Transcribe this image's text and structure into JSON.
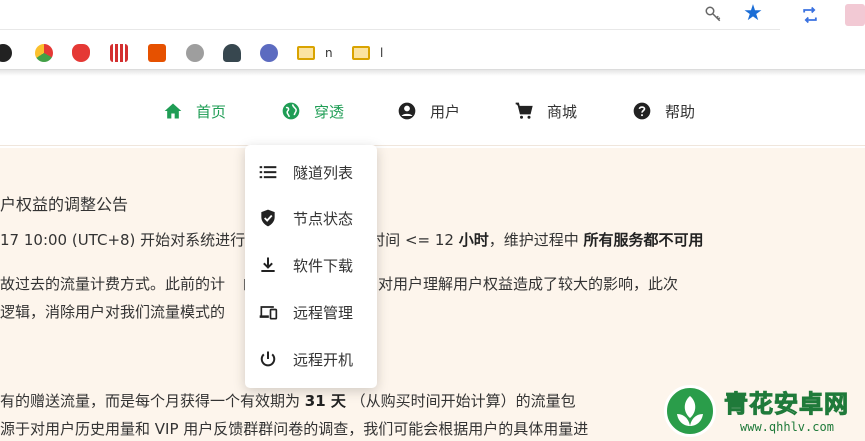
{
  "browser": {
    "icons": [
      "key-icon",
      "star-icon",
      "sync-icon",
      "extension-icon"
    ],
    "bookmarks": [
      {
        "icon": "github-icon",
        "label": ""
      },
      {
        "icon": "browser-icon",
        "label": ""
      },
      {
        "icon": "red-logo-icon",
        "label": ""
      },
      {
        "icon": "huawei-icon",
        "label": ""
      },
      {
        "icon": "orange-app-icon",
        "label": ""
      },
      {
        "icon": "bird-icon",
        "label": ""
      },
      {
        "icon": "tree-icon",
        "label": ""
      },
      {
        "icon": "mascot-icon",
        "label": ""
      },
      {
        "icon": "folder-icon",
        "label": "n"
      },
      {
        "icon": "folder-icon",
        "label": "l"
      }
    ]
  },
  "nav": {
    "items": [
      {
        "label": "首页",
        "icon": "home-icon",
        "active": true
      },
      {
        "label": "穿透",
        "icon": "globe-icon",
        "active": true
      },
      {
        "label": "用户",
        "icon": "account-icon",
        "active": false
      },
      {
        "label": "商城",
        "icon": "cart-icon",
        "active": false
      },
      {
        "label": "帮助",
        "icon": "help-icon",
        "active": false
      }
    ]
  },
  "dropdown": {
    "items": [
      {
        "label": "隧道列表",
        "icon": "list-icon"
      },
      {
        "label": "节点状态",
        "icon": "shield-check-icon"
      },
      {
        "label": "软件下载",
        "icon": "download-icon"
      },
      {
        "label": "远程管理",
        "icon": "devices-icon"
      },
      {
        "label": "远程开机",
        "icon": "power-icon"
      }
    ]
  },
  "content": {
    "line1": "户权益的调整公告",
    "line2_a": "17 10:00 (UTC+8) 开始对系统进行",
    "line2_b": "次维护预计持续时间 <= 12 ",
    "line2_bold1": "小时",
    "line2_c": "，维护过程中 ",
    "line2_bold2": "所有服务都不可用",
    "line3_a": "故过去的流量计费方式。此前的计",
    "line3_b": "的遗留产物，其机制对用户理解用户权益造成了较大的影响，此次",
    "line4_a": "逻辑，消除用户对我们流量模式的",
    "line5_a": "有的赠送流量，而是每个月获得一个有效期为 ",
    "line5_bold": "31 天",
    "line5_b": " （从购买时间开始计算）的流量包",
    "line6_a": "源于对用户历史用量和 VIP 用户反馈群群问卷的调查，我们可能会根据用户的具体用量进"
  },
  "watermark": {
    "title": "青花安卓网",
    "url": "www.qhhlv.com"
  },
  "colors": {
    "accent_green": "#1f9d55",
    "content_bg": "#fdf5ec",
    "star_blue": "#1a6dd6"
  }
}
